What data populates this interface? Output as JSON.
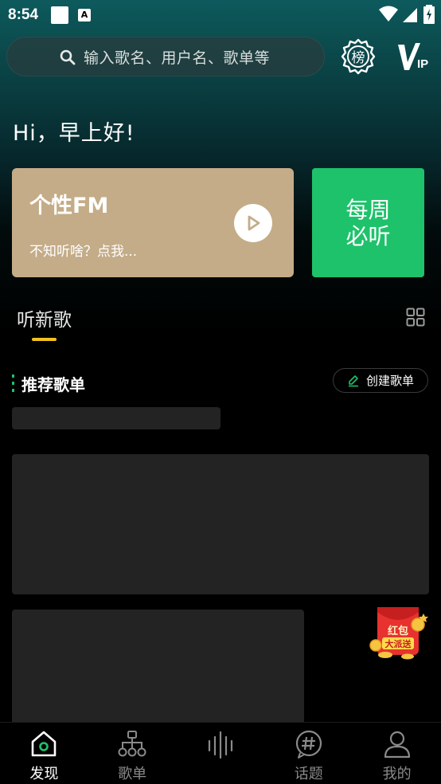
{
  "status_bar": {
    "time": "8:54"
  },
  "search": {
    "placeholder": "输入歌名、用户名、歌单等"
  },
  "header": {
    "rank_icon": "rank-badge-icon",
    "vip_icon": "vip-icon"
  },
  "greeting": "Hi，早上好!",
  "fm_card": {
    "title": "个性FM",
    "subtitle": "不知听啥？点我...",
    "color": "#c4ac88"
  },
  "weekly_card": {
    "line1": "每周",
    "line2": "必听",
    "color": "#1ec26b"
  },
  "tabs": {
    "active_label": "听新歌",
    "indicator_color": "#f2c21b"
  },
  "section": {
    "title": "推荐歌单",
    "create_label": "创建歌单"
  },
  "floating_badge": {
    "line1": "红包",
    "line2": "大派送"
  },
  "bottom_nav": [
    {
      "label": "发现",
      "icon": "home-icon",
      "active": true
    },
    {
      "label": "歌单",
      "icon": "playlist-tree-icon",
      "active": false
    },
    {
      "label": "",
      "icon": "soundwave-icon",
      "active": false
    },
    {
      "label": "话题",
      "icon": "hashtag-icon",
      "active": false
    },
    {
      "label": "我的",
      "icon": "profile-icon",
      "active": false
    }
  ]
}
